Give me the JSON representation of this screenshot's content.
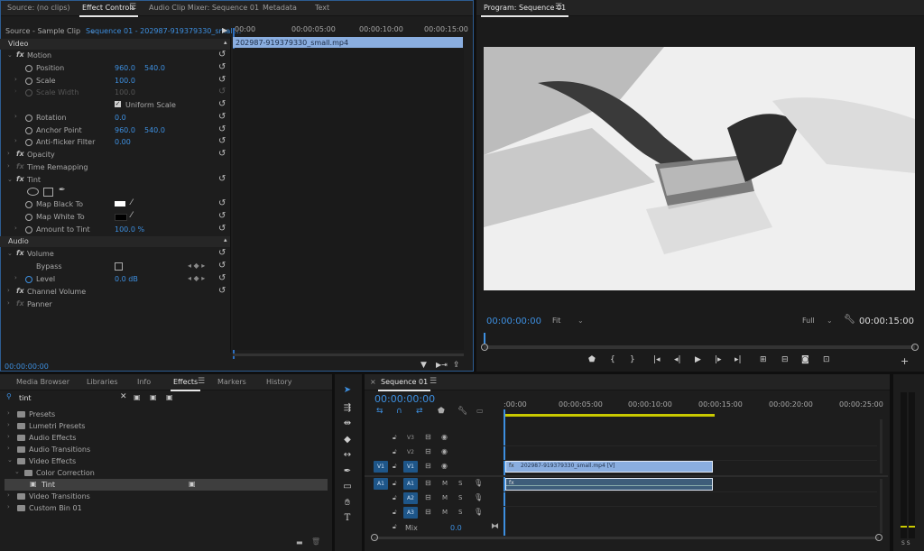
{
  "source_panel": {
    "tabs": [
      "Source: (no clips)",
      "Effect Controls",
      "Audio Clip Mixer: Sequence 01",
      "Metadata",
      "Text"
    ],
    "source_label": "Source - Sample Clip",
    "sequence_label": "Sequence 01 - 202987-919379330_small...",
    "ruler": [
      "00:00",
      "00:00:05:00",
      "00:00:10:00",
      "00:00:15:00"
    ],
    "clip_name": "202987-919379330_small.mp4",
    "timecode": "00:00:00:00"
  },
  "effects_tree": {
    "video_header": "Video",
    "motion": "Motion",
    "position": {
      "label": "Position",
      "x": "960.0",
      "y": "540.0"
    },
    "scale": {
      "label": "Scale",
      "value": "100.0"
    },
    "scale_width": {
      "label": "Scale Width",
      "value": "100.0"
    },
    "uniform_scale": "Uniform Scale",
    "rotation": {
      "label": "Rotation",
      "value": "0.0"
    },
    "anchor_point": {
      "label": "Anchor Point",
      "x": "960.0",
      "y": "540.0"
    },
    "anti_flicker": {
      "label": "Anti-flicker Filter",
      "value": "0.00"
    },
    "opacity": "Opacity",
    "time_remapping": "Time Remapping",
    "tint": "Tint",
    "map_black": "Map Black To",
    "map_white": "Map White To",
    "amount_to_tint": {
      "label": "Amount to Tint",
      "value": "100.0 %"
    },
    "audio_header": "Audio",
    "volume": "Volume",
    "bypass": "Bypass",
    "level": {
      "label": "Level",
      "value": "0.0 dB"
    },
    "channel_volume": "Channel Volume",
    "panner": "Panner"
  },
  "program_monitor": {
    "title": "Program: Sequence 01",
    "timecode": "00:00:00:00",
    "fit": "Fit",
    "quality": "Full",
    "duration": "00:00:15:00"
  },
  "effects_panel": {
    "tabs": [
      "Media Browser",
      "Libraries",
      "Info",
      "Effects",
      "Markers",
      "History"
    ],
    "search_value": "tint",
    "tree": [
      "Presets",
      "Lumetri Presets",
      "Audio Effects",
      "Audio Transitions",
      "Video Effects",
      "Color Correction",
      "Tint",
      "Video Transitions",
      "Custom Bin 01"
    ]
  },
  "timeline": {
    "tab": "Sequence 01",
    "timecode": "00:00:00:00",
    "ruler": [
      ":00:00",
      "00:00:05:00",
      "00:00:10:00",
      "00:00:15:00",
      "00:00:20:00",
      "00:00:25:00"
    ],
    "tracks": [
      "V3",
      "V2",
      "V1",
      "A1",
      "A2",
      "A3"
    ],
    "source_patch_v": "V1",
    "source_patch_a": "A1",
    "mix_label": "Mix",
    "mix_value": "0.0",
    "clip_video": "202987-919379330_small.mp4 [V]",
    "m_label": "M",
    "s_label": "S"
  },
  "meter": {
    "labels": "S S"
  }
}
